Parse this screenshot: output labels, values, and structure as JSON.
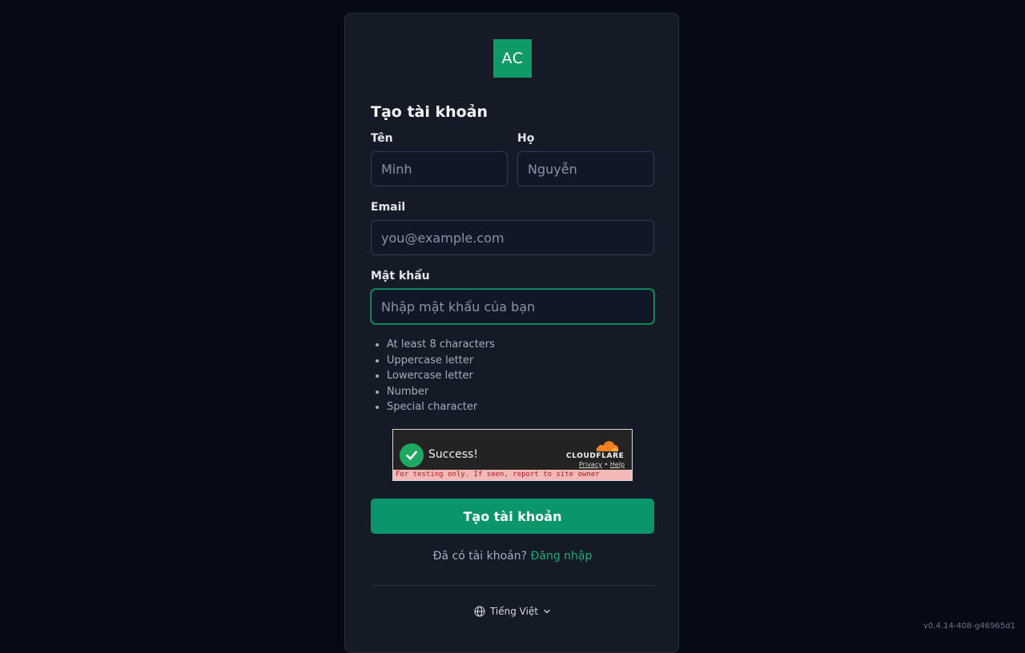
{
  "logo": {
    "text": "AC",
    "color": "#0f9a68"
  },
  "form": {
    "title": "Tạo tài khoản",
    "first_name": {
      "label": "Tên",
      "placeholder": "Minh",
      "value": ""
    },
    "last_name": {
      "label": "Họ",
      "placeholder": "Nguyễn",
      "value": ""
    },
    "email": {
      "label": "Email",
      "placeholder": "you@example.com",
      "value": ""
    },
    "password": {
      "label": "Mật khẩu",
      "placeholder": "Nhập mật khẩu của bạn",
      "value": "",
      "focused": true
    },
    "password_rules": [
      "At least 8 characters",
      "Uppercase letter",
      "Lowercase letter",
      "Number",
      "Special character"
    ],
    "submit_label": "Tạo tài khoản",
    "signin_prompt": "Đã có tài khoản?",
    "signin_link": "Đăng nhập"
  },
  "captcha": {
    "status": "Success!",
    "brand": "CLOUDFLARE",
    "privacy": "Privacy",
    "separator": "•",
    "help": "Help",
    "warning": "For testing only. If seen, report to site owner"
  },
  "language": {
    "icon": "globe-icon",
    "selected": "Tiếng Việt"
  },
  "version": "v0.4.14-408-g46965d1",
  "colors": {
    "accent": "#0a966a",
    "link": "#1faa78",
    "background": "#050a14",
    "card": "#141a26"
  }
}
